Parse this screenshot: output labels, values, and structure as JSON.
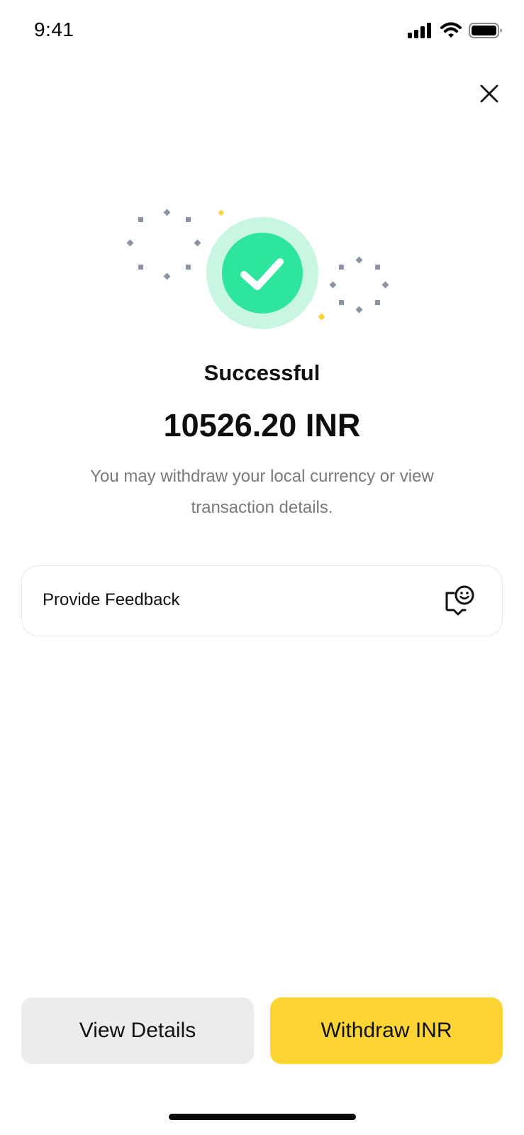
{
  "status_bar": {
    "time": "9:41",
    "icons": [
      "signal-icon",
      "wifi-icon",
      "battery-icon"
    ]
  },
  "header": {
    "close_icon": "close-icon"
  },
  "hero": {
    "icon": "success-check-icon",
    "colors": {
      "check_circle": "#2ee59d",
      "halo": "#c8f6e3",
      "confetti_gray": "#8a94a6",
      "confetti_yellow": "#fcd535"
    }
  },
  "result": {
    "title": "Successful",
    "amount": "10526.20 INR",
    "description": "You may withdraw your local currency or view transaction details."
  },
  "feedback": {
    "label": "Provide Feedback",
    "icon": "feedback-smile-icon"
  },
  "actions": {
    "view_details_label": "View Details",
    "withdraw_label": "Withdraw INR",
    "primary_color": "#fcd535",
    "secondary_color": "#ececec"
  }
}
